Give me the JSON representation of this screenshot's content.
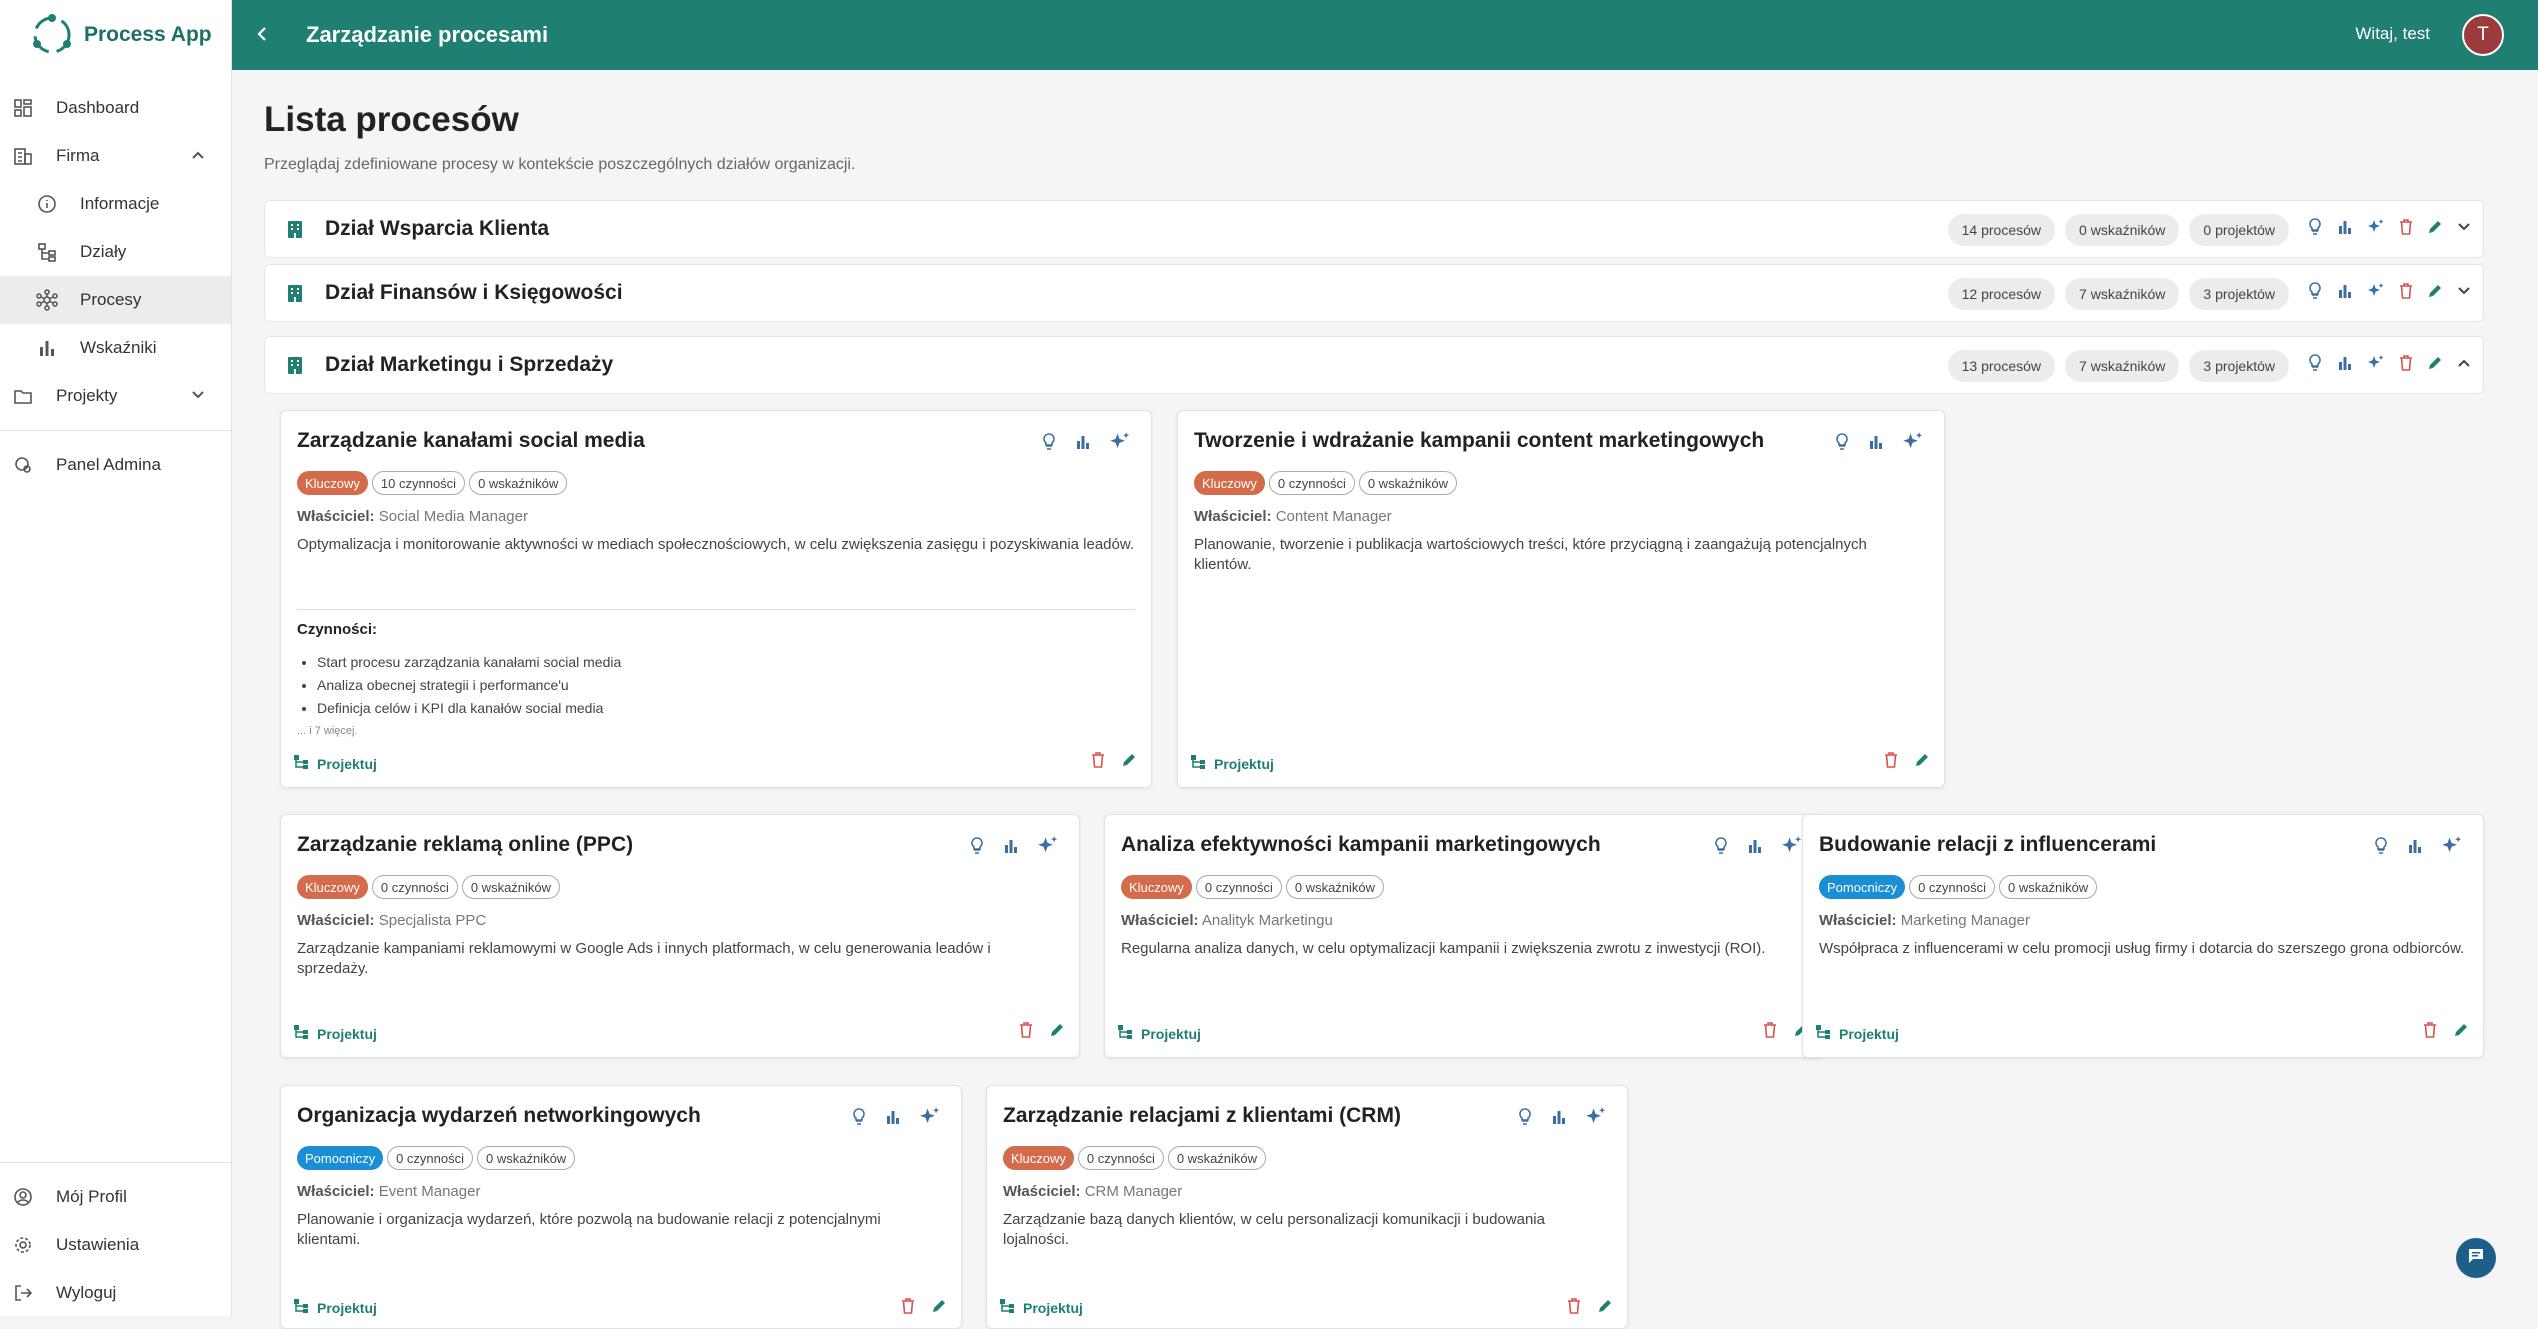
{
  "app": {
    "name": "Process App"
  },
  "sidebar": {
    "items": [
      {
        "label": "Dashboard"
      },
      {
        "label": "Firma"
      },
      {
        "label": "Informacje"
      },
      {
        "label": "Działy"
      },
      {
        "label": "Procesy"
      },
      {
        "label": "Wskaźniki"
      },
      {
        "label": "Projekty"
      },
      {
        "label": "Panel Admina"
      }
    ],
    "bottom": [
      {
        "label": "Mój Profil"
      },
      {
        "label": "Ustawienia"
      },
      {
        "label": "Wyloguj"
      }
    ]
  },
  "topbar": {
    "title": "Zarządzanie procesami",
    "greeting": "Witaj, test",
    "avatar_initial": "T"
  },
  "page": {
    "title": "Lista procesów",
    "subtitle": "Przeglądaj zdefiniowane procesy w kontekście poszczególnych działów organizacji."
  },
  "departments": [
    {
      "name": "Dział Wsparcia Klienta",
      "processes": "14 procesów",
      "indicators": "0 wskaźników",
      "projects": "0 projektów"
    },
    {
      "name": "Dział Finansów i Księgowości",
      "processes": "12 procesów",
      "indicators": "7 wskaźników",
      "projects": "3 projektów"
    },
    {
      "name": "Dział Marketingu i Sprzedaży",
      "processes": "13 procesów",
      "indicators": "7 wskaźników",
      "projects": "3 projektów"
    }
  ],
  "owner_label": "Właściciel:",
  "project_label": "Projektuj",
  "activities_label": "Czynności:",
  "cards": [
    {
      "title": "Zarządzanie kanałami social media",
      "type": "Kluczowy",
      "activities": "10 czynności",
      "indicators": "0 wskaźników",
      "owner": "Social Media Manager",
      "desc": "Optymalizacja i monitorowanie aktywności w mediach społecznościowych, w celu zwiększenia zasięgu i pozyskiwania leadów.",
      "activity_list": [
        "Start procesu zarządzania kanałami social media",
        "Analiza obecnej strategii i performance'u",
        "Definicja celów i KPI dla kanałów social media"
      ],
      "more": "... i 7 więcej."
    },
    {
      "title": "Tworzenie i wdrażanie kampanii content marketingowych",
      "type": "Kluczowy",
      "activities": "0 czynności",
      "indicators": "0 wskaźników",
      "owner": "Content Manager",
      "desc": "Planowanie, tworzenie i publikacja wartościowych treści, które przyciągną i zaangażują potencjalnych klientów."
    },
    {
      "title": "Zarządzanie reklamą online (PPC)",
      "type": "Kluczowy",
      "activities": "0 czynności",
      "indicators": "0 wskaźników",
      "owner": "Specjalista PPC",
      "desc": "Zarządzanie kampaniami reklamowymi w Google Ads i innych platformach, w celu generowania leadów i sprzedaży."
    },
    {
      "title": "Analiza efektywności kampanii marketingowych",
      "type": "Kluczowy",
      "activities": "0 czynności",
      "indicators": "0 wskaźników",
      "owner": "Analityk Marketingu",
      "desc": "Regularna analiza danych, w celu optymalizacji kampanii i zwiększenia zwrotu z inwestycji (ROI)."
    },
    {
      "title": "Budowanie relacji z influencerami",
      "type": "Pomocniczy",
      "activities": "0 czynności",
      "indicators": "0 wskaźników",
      "owner": "Marketing Manager",
      "desc": "Współpraca z influencerami w celu promocji usług firmy i dotarcia do szerszego grona odbiorców."
    },
    {
      "title": "Organizacja wydarzeń networkingowych",
      "type": "Pomocniczy",
      "activities": "0 czynności",
      "indicators": "0 wskaźników",
      "owner": "Event Manager",
      "desc": "Planowanie i organizacja wydarzeń, które pozwolą na budowanie relacji z potencjalnymi klientami."
    },
    {
      "title": "Zarządzanie relacjami z klientami (CRM)",
      "type": "Kluczowy",
      "activities": "0 czynności",
      "indicators": "0 wskaźników",
      "owner": "CRM Manager",
      "desc": "Zarządzanie bazą danych klientów, w celu personalizacji komunikacji i budowania lojalności."
    }
  ],
  "colors": {
    "primary": "#1e7f72",
    "key_badge": "#d46b4a",
    "support_badge": "#1a8fd6",
    "delete": "#d9534f",
    "icon_blue": "#3b6ea5"
  }
}
